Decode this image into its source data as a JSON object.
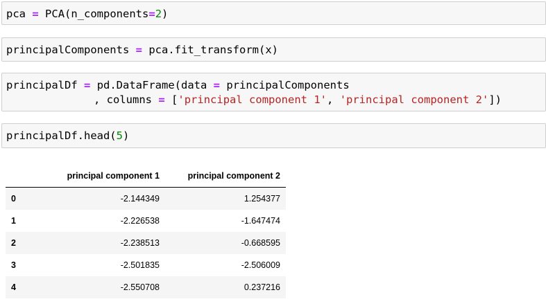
{
  "cells": [
    {
      "line": {
        "var": "pca",
        "op": "=",
        "call": "PCA(n_components",
        "op2": "=",
        "num": "2",
        "close": ")"
      }
    },
    {
      "line": {
        "var": "principalComponents",
        "op": "=",
        "call": "pca.fit_transform(x)"
      }
    },
    {
      "line1": {
        "var": "principalDf",
        "op": "=",
        "call": "pd.DataFrame(data",
        "op2": "=",
        "arg": "principalComponents"
      },
      "line2": {
        "prefix": ", columns",
        "op": "=",
        "open": "[",
        "str1": "'principal component 1'",
        "sep": ", ",
        "str2": "'principal component 2'",
        "close": "])"
      }
    },
    {
      "line": {
        "call": "principalDf.head(",
        "num": "5",
        "close": ")"
      }
    }
  ],
  "output_table": {
    "columns": [
      "principal component 1",
      "principal component 2"
    ],
    "rows": [
      {
        "index": "0",
        "values": [
          "-2.144349",
          "1.254377"
        ]
      },
      {
        "index": "1",
        "values": [
          "-2.226538",
          "-1.647474"
        ]
      },
      {
        "index": "2",
        "values": [
          "-2.238513",
          "-0.668595"
        ]
      },
      {
        "index": "3",
        "values": [
          "-2.501835",
          "-2.506009"
        ]
      },
      {
        "index": "4",
        "values": [
          "-2.550708",
          "0.237216"
        ]
      }
    ]
  }
}
